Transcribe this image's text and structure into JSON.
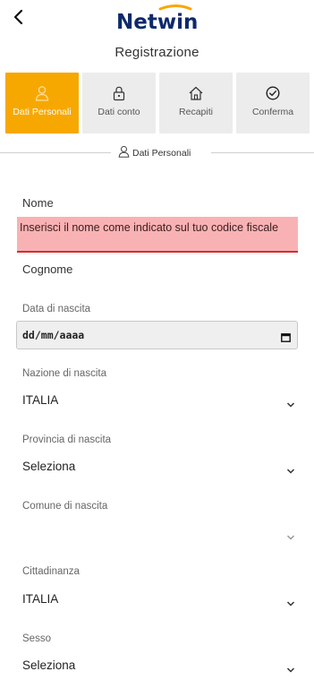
{
  "header": {
    "logo_text": "Netwin"
  },
  "page_title": "Registrazione",
  "steps": [
    {
      "label": "Dati Personali",
      "icon": "user-icon",
      "active": true
    },
    {
      "label": "Dati conto",
      "icon": "lock-icon",
      "active": false
    },
    {
      "label": "Recapiti",
      "icon": "home-icon",
      "active": false
    },
    {
      "label": "Conferma",
      "icon": "check-circle-icon",
      "active": false
    }
  ],
  "section": {
    "title": "Dati Personali",
    "icon": "user-icon"
  },
  "form": {
    "nome_label": "Nome",
    "nome_error": "Inserisci il nome come indicato sul tuo codice fiscale",
    "cognome_label": "Cognome",
    "data_label": "Data di nascita",
    "data_value": "dd/mm/aaaa",
    "nazione_label": "Nazione di nascita",
    "nazione_value": "ITALIA",
    "provincia_label": "Provincia di nascita",
    "provincia_value": "Seleziona",
    "comune_label": "Comune di nascita",
    "comune_value": "",
    "cittadinanza_label": "Cittadinanza",
    "cittadinanza_value": "ITALIA",
    "sesso_label": "Sesso",
    "sesso_value": "Seleziona"
  },
  "colors": {
    "accent": "#f7a800",
    "error_bg": "#f9b2b4",
    "error_line": "#d32f2f",
    "brand_blue": "#0d2a6b"
  }
}
